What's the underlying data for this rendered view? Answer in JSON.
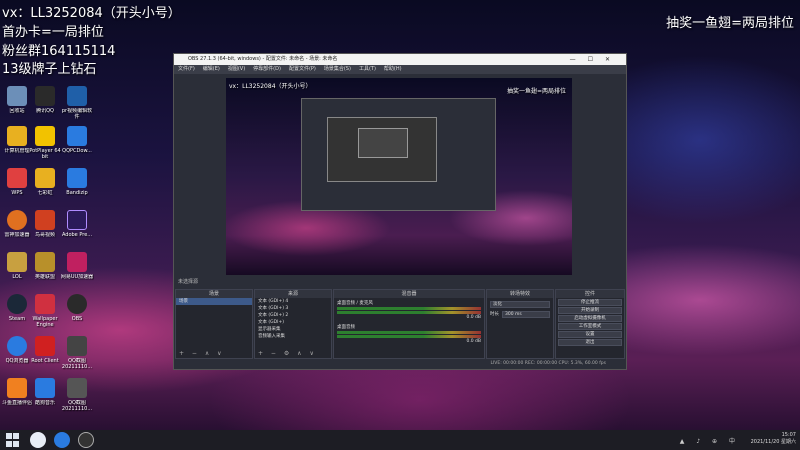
{
  "overlay": {
    "line1": "vx：LL3252084（开头小号）",
    "line2": "首办卡=一局排位",
    "line3": "粉丝群164115114",
    "line4": "13级牌子上钻石",
    "right": "抽奖一鱼翅=两局排位"
  },
  "desktop_icons": [
    {
      "label": "回收站",
      "color": "#6c8fb8"
    },
    {
      "label": "腾讯QQ",
      "color": "#2a2a2a"
    },
    {
      "label": "pr视频编辑软件",
      "color": "#1f5fa8"
    },
    {
      "label": "计算机管理",
      "color": "#e8b020"
    },
    {
      "label": "PotPlayer 64 bit",
      "color": "#f2c200"
    },
    {
      "label": "QQPCDow...",
      "color": "#2a7be0"
    },
    {
      "label": "WPS",
      "color": "#e04040"
    },
    {
      "label": "七彩虹",
      "color": "#e8b020"
    },
    {
      "label": "Bandizip",
      "color": "#2a7be0"
    },
    {
      "label": "雷神加速器",
      "color": "#e07020"
    },
    {
      "label": "鸟哥视频",
      "color": "#d04020"
    },
    {
      "label": "Adobe Pre...",
      "color": "#2b1a5a"
    },
    {
      "label": "LOL",
      "color": "#c8a040"
    },
    {
      "label": "英雄联盟",
      "color": "#b8902a"
    },
    {
      "label": "网易UU加速器",
      "color": "#c02060"
    },
    {
      "label": "Steam",
      "color": "#1b2838"
    },
    {
      "label": "Wallpaper Engine",
      "color": "#d03040"
    },
    {
      "label": "OBS",
      "color": "#2a2a2a"
    },
    {
      "label": "QQ浏览器",
      "color": "#2a7be0"
    },
    {
      "label": "Root Client",
      "color": "#d02020"
    },
    {
      "label": "QQ截图20211110...",
      "color": "#444"
    },
    {
      "label": "斗鱼直播伴侣",
      "color": "#f08020"
    },
    {
      "label": "酷狗音乐",
      "color": "#2a7be0"
    },
    {
      "label": "QQ截图20211110...",
      "color": "#555"
    }
  ],
  "obs": {
    "title": "OBS 27.1.3 (64-bit, windows) - 配置文件: 未命名 - 场景: 未命名",
    "menu": [
      "文件(F)",
      "编辑(E)",
      "视图(V)",
      "停靠部件(D)",
      "配置文件(P)",
      "场景集合(S)",
      "工具(T)",
      "帮助(H)"
    ],
    "preview_top": "vx：LL3252084（开头小号）",
    "preview_right": "抽奖一鱼翅=两局排位",
    "toolbar": "未选择源",
    "docks": {
      "scenes": "场景",
      "sources": "来源",
      "mixer": "混音器",
      "transitions": "转场特效",
      "controls": "控件"
    },
    "scenes": [
      "场景"
    ],
    "sources": [
      "文本 (GDI+) 4",
      "文本 (GDI+) 3",
      "文本 (GDI+) 2",
      "文本 (GDI+)",
      "显示器采集",
      "音频输入采集"
    ],
    "mixer": [
      {
        "name": "桌面音频 / 麦克风",
        "db": "0.0 dB"
      },
      {
        "name": "桌面音频",
        "db": "0.0 dB"
      }
    ],
    "transition": {
      "type": "淡化",
      "duration_label": "时长",
      "duration": "300 ms"
    },
    "controls": [
      "停止推流",
      "开始录制",
      "启动虚拟摄像机",
      "工作室模式",
      "设置",
      "退出"
    ],
    "status": "LIVE: 00:00:00   REC: 00:00:00   CPU: 5.3%, 60.00 fps"
  },
  "taskbar": {
    "time": "15:07",
    "date": "2021/11/20 星期六"
  }
}
